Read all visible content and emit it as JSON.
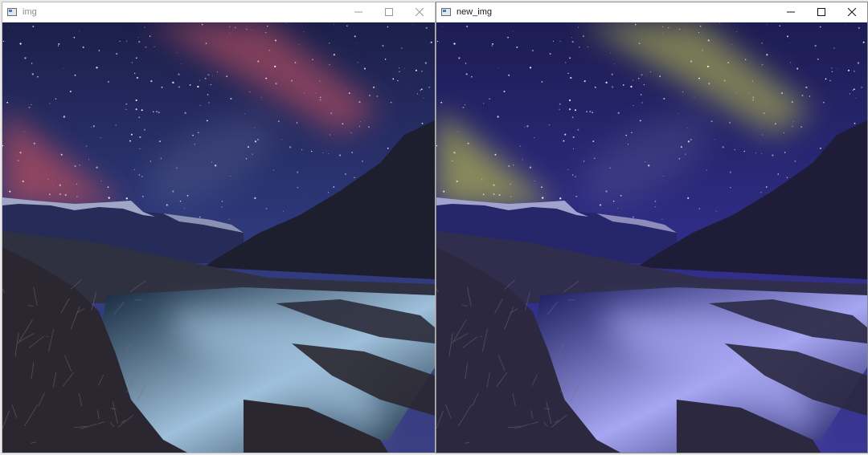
{
  "windows": [
    {
      "title": "img",
      "palette": {
        "sky_top": "#1c1f4a",
        "sky_mid": "#2f3a7d",
        "sky_low": "#3a3f82",
        "aurora": "#a24a5e",
        "mountain_far": "#262c58",
        "snow": "#b6bcd8",
        "mountain_right": "#1e1f2e",
        "lowland": "#2f3140",
        "water_dark": "#13263a",
        "water_light": "#9fc0db",
        "foreground": "#2a2730"
      }
    },
    {
      "title": "new_img",
      "palette": {
        "sky_top": "#1d1c52",
        "sky_mid": "#2f2d86",
        "sky_low": "#3a3792",
        "aurora": "#9a9b55",
        "mountain_far": "#26266a",
        "snow": "#b9b8e0",
        "mountain_right": "#1e1c36",
        "lowland": "#302e4c",
        "water_dark": "#16195a",
        "water_light": "#a7a6f2",
        "foreground": "#2b2840"
      }
    }
  ],
  "controls": {
    "minimize": "minimize-icon",
    "maximize": "maximize-icon",
    "close": "close-icon"
  }
}
